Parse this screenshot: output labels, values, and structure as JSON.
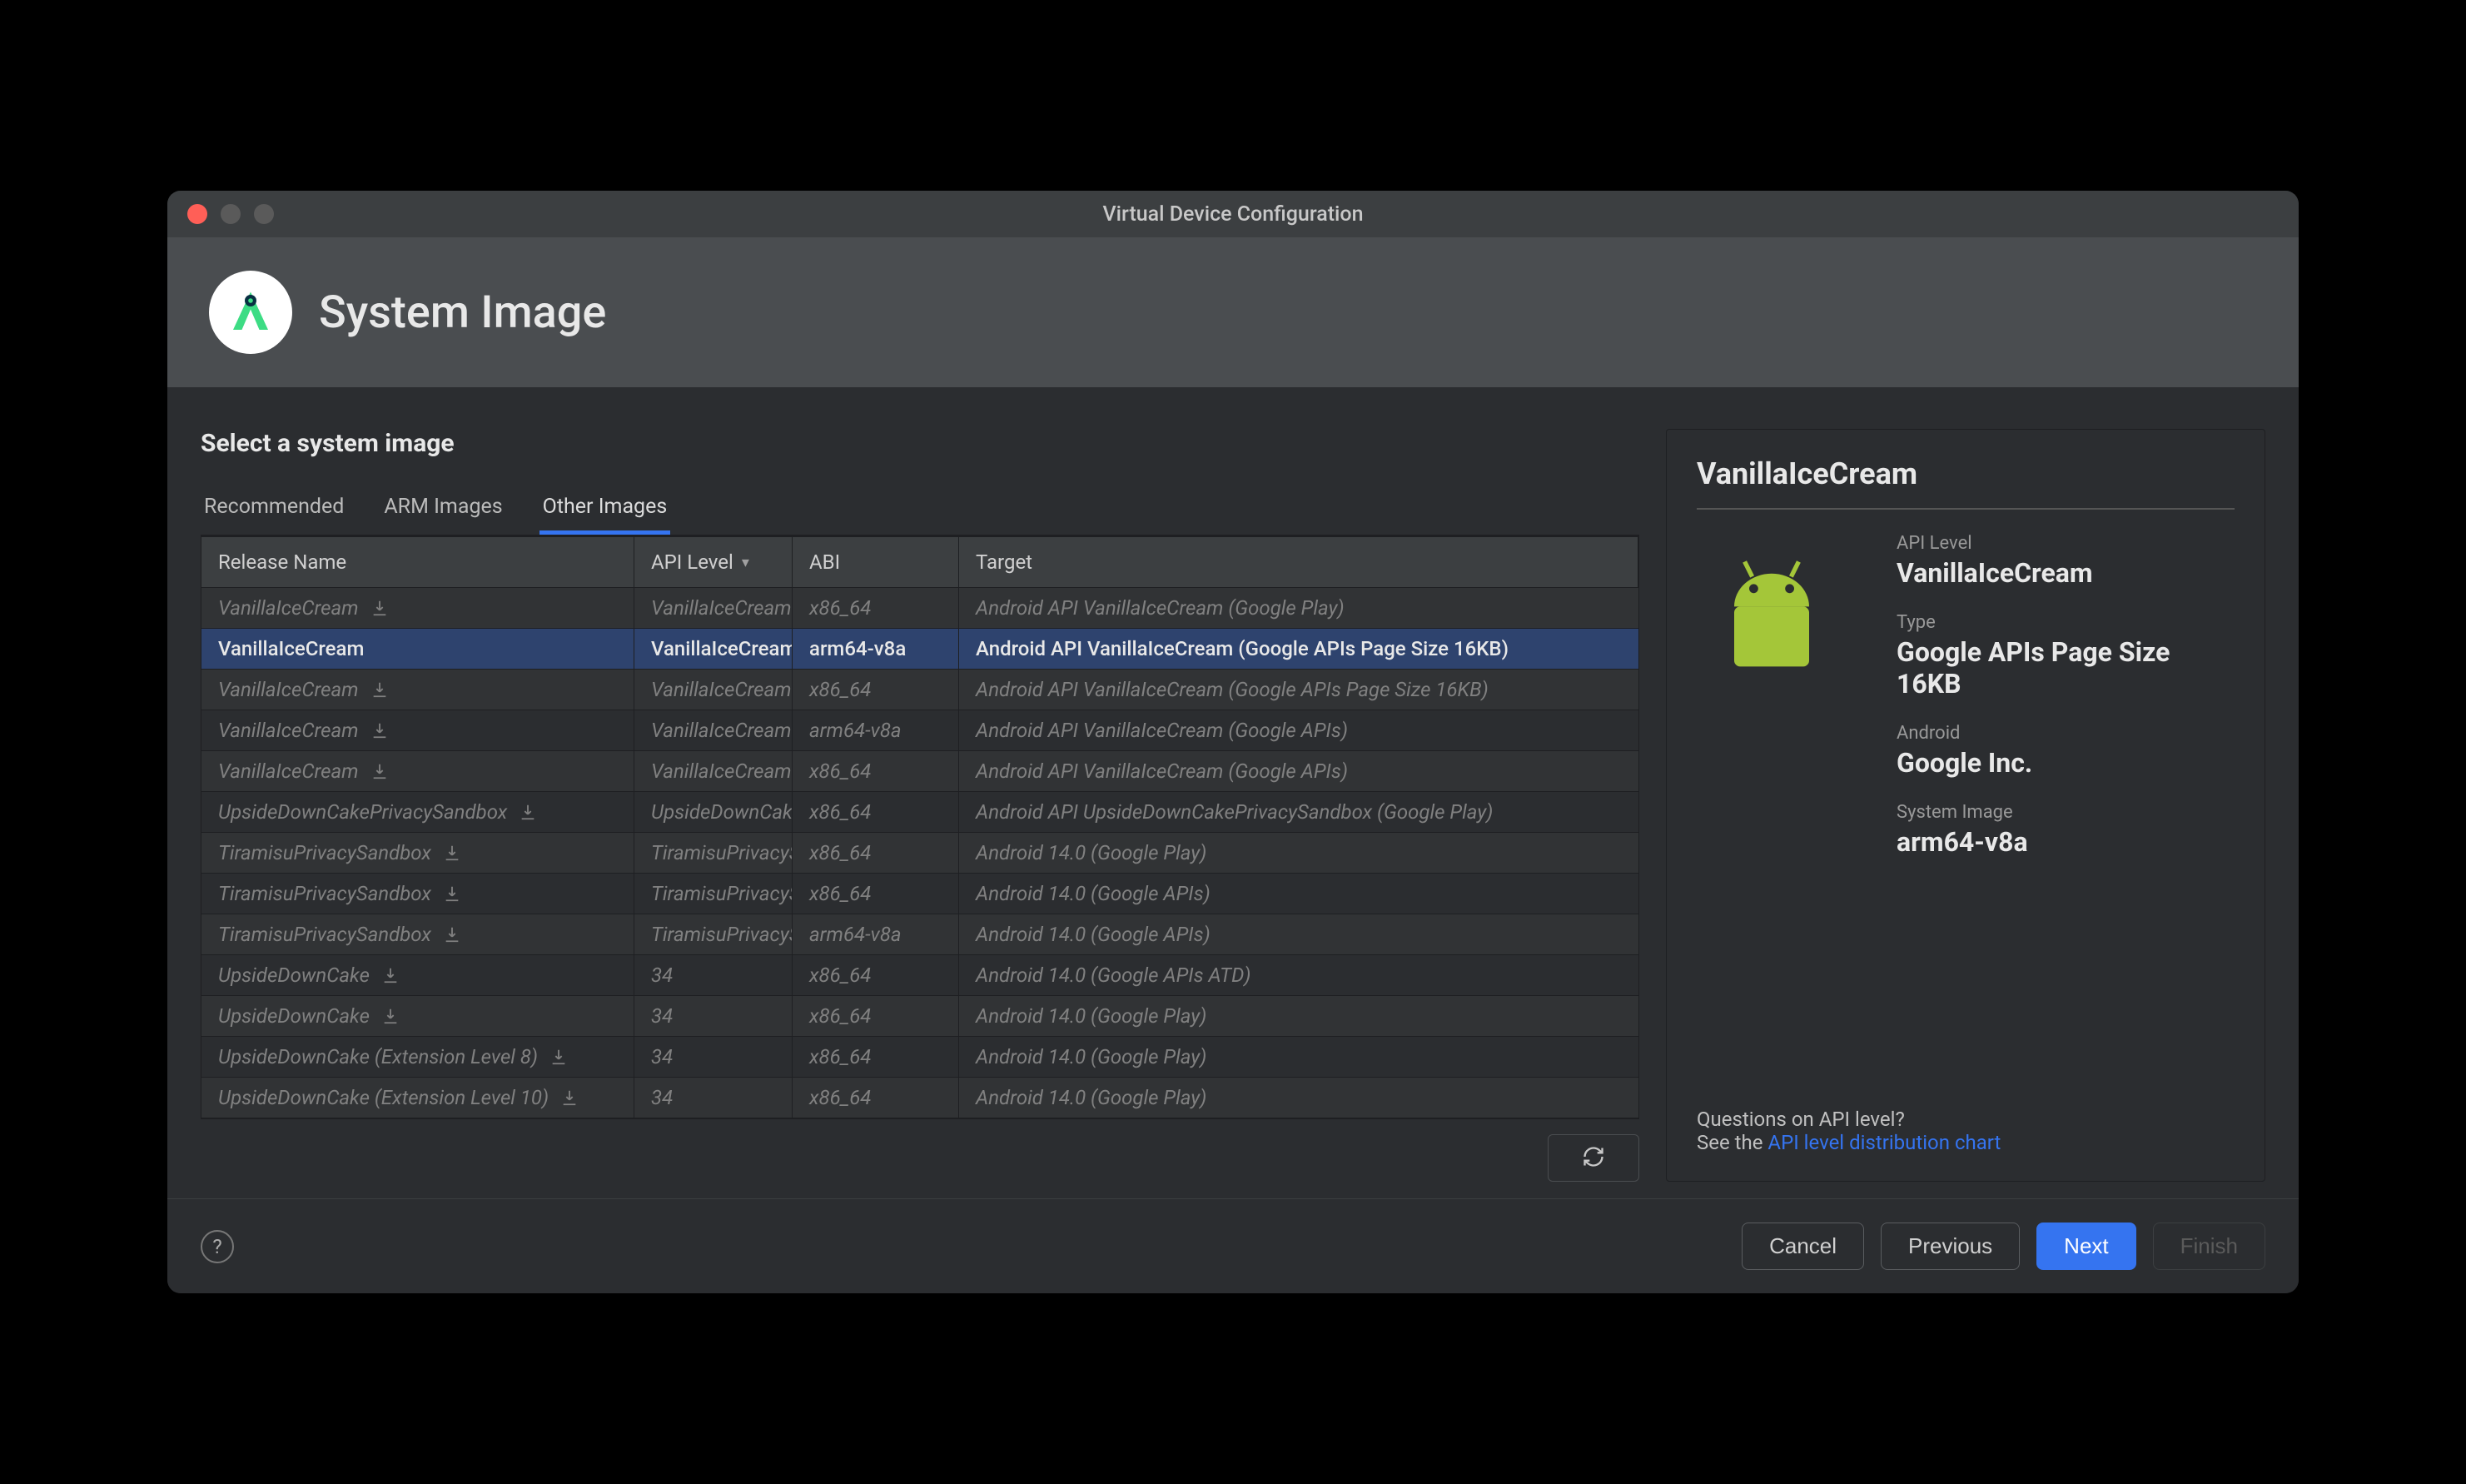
{
  "window_title": "Virtual Device Configuration",
  "header_title": "System Image",
  "subtitle": "Select a system image",
  "tabs": [
    {
      "label": "Recommended"
    },
    {
      "label": "ARM Images"
    },
    {
      "label": "Other Images"
    }
  ],
  "columns": {
    "release": "Release Name",
    "api": "API Level",
    "abi": "ABI",
    "target": "Target"
  },
  "rows": [
    {
      "release": "VanillaIceCream",
      "api": "VanillaIceCream",
      "abi": "x86_64",
      "target": "Android API VanillaIceCream (Google Play)",
      "download": true,
      "selected": false
    },
    {
      "release": "VanillaIceCream",
      "api": "VanillaIceCream",
      "abi": "arm64-v8a",
      "target": "Android API VanillaIceCream (Google APIs Page Size 16KB)",
      "download": false,
      "selected": true
    },
    {
      "release": "VanillaIceCream",
      "api": "VanillaIceCream",
      "abi": "x86_64",
      "target": "Android API VanillaIceCream (Google APIs Page Size 16KB)",
      "download": true,
      "selected": false
    },
    {
      "release": "VanillaIceCream",
      "api": "VanillaIceCream",
      "abi": "arm64-v8a",
      "target": "Android API VanillaIceCream (Google APIs)",
      "download": true,
      "selected": false
    },
    {
      "release": "VanillaIceCream",
      "api": "VanillaIceCream",
      "abi": "x86_64",
      "target": "Android API VanillaIceCream (Google APIs)",
      "download": true,
      "selected": false
    },
    {
      "release": "UpsideDownCakePrivacySandbox",
      "api": "UpsideDownCak",
      "abi": "x86_64",
      "target": "Android API UpsideDownCakePrivacySandbox (Google Play)",
      "download": true,
      "selected": false
    },
    {
      "release": "TiramisuPrivacySandbox",
      "api": "TiramisuPrivacyS",
      "abi": "x86_64",
      "target": "Android 14.0 (Google Play)",
      "download": true,
      "selected": false
    },
    {
      "release": "TiramisuPrivacySandbox",
      "api": "TiramisuPrivacyS",
      "abi": "x86_64",
      "target": "Android 14.0 (Google APIs)",
      "download": true,
      "selected": false
    },
    {
      "release": "TiramisuPrivacySandbox",
      "api": "TiramisuPrivacyS",
      "abi": "arm64-v8a",
      "target": "Android 14.0 (Google APIs)",
      "download": true,
      "selected": false
    },
    {
      "release": "UpsideDownCake",
      "api": "34",
      "abi": "x86_64",
      "target": "Android 14.0 (Google APIs ATD)",
      "download": true,
      "selected": false
    },
    {
      "release": "UpsideDownCake",
      "api": "34",
      "abi": "x86_64",
      "target": "Android 14.0 (Google Play)",
      "download": true,
      "selected": false
    },
    {
      "release": "UpsideDownCake (Extension Level 8)",
      "api": "34",
      "abi": "x86_64",
      "target": "Android 14.0 (Google Play)",
      "download": true,
      "selected": false
    },
    {
      "release": "UpsideDownCake (Extension Level 10)",
      "api": "34",
      "abi": "x86_64",
      "target": "Android 14.0 (Google Play)",
      "download": true,
      "selected": false
    }
  ],
  "detail": {
    "title": "VanillaIceCream",
    "items": [
      {
        "label": "API Level",
        "value": "VanillaIceCream"
      },
      {
        "label": "Type",
        "value": "Google APIs Page Size 16KB"
      },
      {
        "label": "Android",
        "value": "Google Inc."
      },
      {
        "label": "System Image",
        "value": "arm64-v8a"
      }
    ],
    "help_question": "Questions on API level?",
    "help_prefix": "See the ",
    "help_link": "API level distribution chart"
  },
  "buttons": {
    "cancel": "Cancel",
    "previous": "Previous",
    "next": "Next",
    "finish": "Finish"
  },
  "icons": {
    "download": "download-icon",
    "refresh": "refresh-icon",
    "help": "?"
  },
  "colors": {
    "accent": "#3574f0",
    "android_green": "#a4c639"
  }
}
